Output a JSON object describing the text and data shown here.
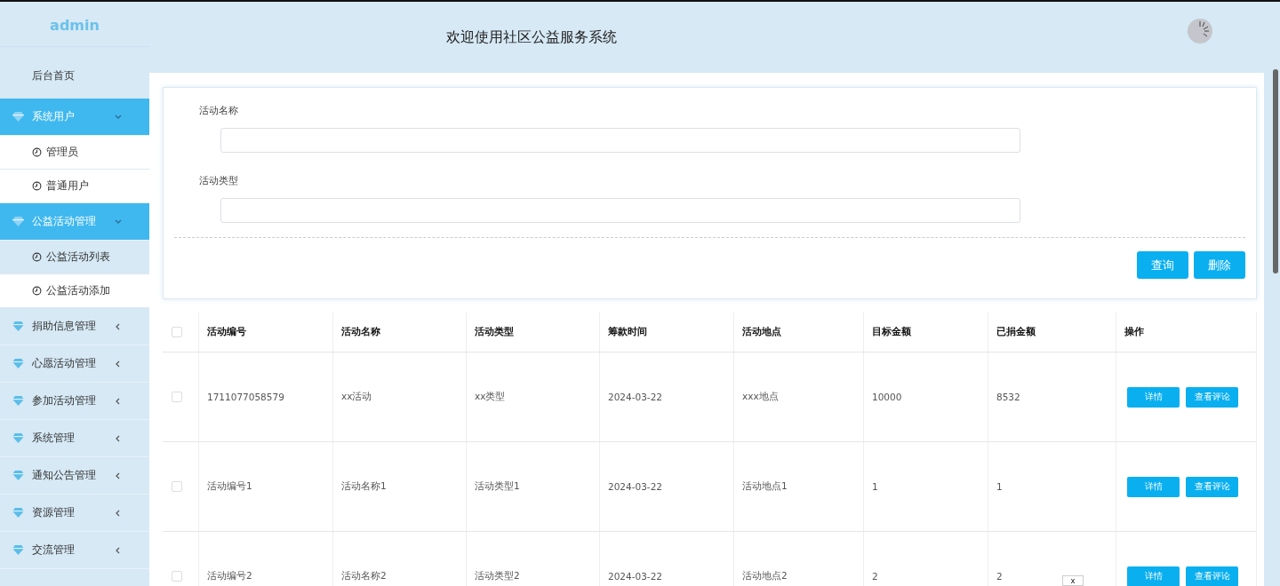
{
  "sidebar": {
    "user": "admin",
    "items": [
      {
        "kind": "link",
        "label": "后台首页"
      },
      {
        "kind": "group",
        "label": "系统用户",
        "expanded": true,
        "children": [
          {
            "label": "管理员",
            "selected": false
          },
          {
            "label": "普通用户",
            "selected": false
          }
        ]
      },
      {
        "kind": "group",
        "label": "公益活动管理",
        "expanded": true,
        "children": [
          {
            "label": "公益活动列表",
            "selected": true
          },
          {
            "label": "公益活动添加",
            "selected": false
          }
        ]
      },
      {
        "kind": "group",
        "label": "捐助信息管理",
        "expanded": false
      },
      {
        "kind": "group",
        "label": "心愿活动管理",
        "expanded": false
      },
      {
        "kind": "group",
        "label": "参加活动管理",
        "expanded": false
      },
      {
        "kind": "group",
        "label": "系统管理",
        "expanded": false
      },
      {
        "kind": "group",
        "label": "通知公告管理",
        "expanded": false
      },
      {
        "kind": "group",
        "label": "资源管理",
        "expanded": false
      },
      {
        "kind": "group",
        "label": "交流管理",
        "expanded": false
      }
    ]
  },
  "header": {
    "title": "欢迎使用社区公益服务系统"
  },
  "search": {
    "fields": [
      {
        "label": "活动名称"
      },
      {
        "label": "活动类型"
      }
    ],
    "buttons": [
      "查询",
      "删除"
    ]
  },
  "table": {
    "all_checked": false,
    "columns": [
      "活动编号",
      "活动名称",
      "活动类型",
      "筹款时间",
      "活动地点",
      "目标金额",
      "已捐金额",
      "操作"
    ],
    "rows": [
      {
        "checked": false,
        "cells": [
          "1711077058579",
          "xx活动",
          "xx类型",
          "2024-03-22",
          "xxx地点",
          "10000",
          "8532"
        ],
        "actions": [
          "详情",
          "查看评论"
        ]
      },
      {
        "checked": false,
        "cells": [
          "活动编号1",
          "活动名称1",
          "活动类型1",
          "2024-03-22",
          "活动地点1",
          "1",
          "1"
        ],
        "actions": [
          "详情",
          "查看评论"
        ]
      },
      {
        "checked": false,
        "cells": [
          "活动编号2",
          "活动名称2",
          "活动类型2",
          "2024-03-22",
          "活动地点2",
          "2",
          "2"
        ],
        "actions": [
          "详情",
          "查看评论"
        ]
      }
    ]
  },
  "close_label": "x"
}
